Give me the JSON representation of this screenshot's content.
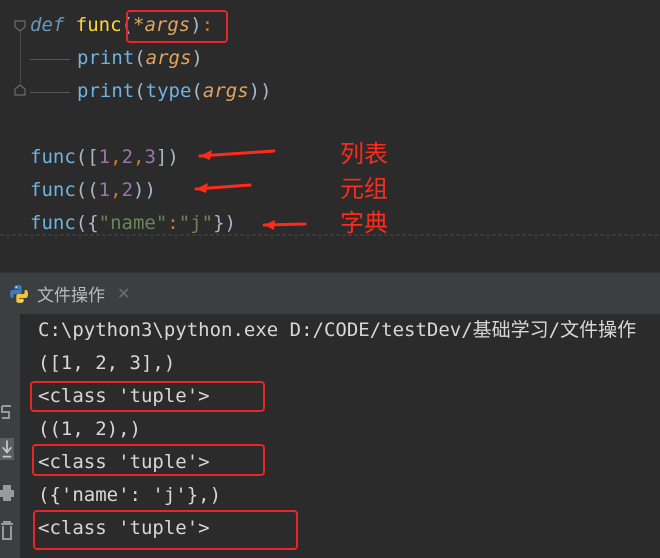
{
  "editor": {
    "lines": {
      "def_kw": "def",
      "def_name": "func",
      "def_open": "(",
      "def_star": "*",
      "def_param": "args",
      "def_close": ")",
      "def_colon": ":",
      "print1_fn": "print",
      "print1_open": "(",
      "print1_arg": "args",
      "print1_close": ")",
      "print2_fn": "print",
      "print2_open": "(",
      "print2_type": "type",
      "print2_open2": "(",
      "print2_arg": "args",
      "print2_close": "))",
      "call1_fn": "func",
      "call1_open": "([",
      "call1_n1": "1",
      "call1_c1": ",",
      "call1_n2": "2",
      "call1_c2": ",",
      "call1_n3": "3",
      "call1_close": "])",
      "call2_fn": "func",
      "call2_open": "((",
      "call2_n1": "1",
      "call2_c1": ",",
      "call2_n2": "2",
      "call2_close": "))",
      "call3_fn": "func",
      "call3_open": "({",
      "call3_key": "\"name\"",
      "call3_colon": ":",
      "call3_val": "\"j\"",
      "call3_close": "})"
    },
    "annotations": {
      "list": "列表",
      "tuple": "元组",
      "dict": "字典"
    },
    "annotation_color": "#ff2a1a"
  },
  "run_panel": {
    "tab_title": "文件操作",
    "close_glyph": "✕",
    "output": [
      "C:\\python3\\python.exe D:/CODE/testDev/基础学习/文件操作",
      "([1, 2, 3],)",
      "<class 'tuple'>",
      "((1, 2),)",
      "<class 'tuple'>",
      "({'name': 'j'},)",
      "<class 'tuple'>"
    ]
  },
  "colors": {
    "background": "#2b2b2b",
    "panel": "#3c3f41",
    "highlight_box": "#e8262a"
  },
  "icons": {
    "run_tab_icon": "python-icon",
    "toolbar": [
      "rerun-icon",
      "scroll-down-icon",
      "print-icon",
      "trash-icon"
    ]
  }
}
